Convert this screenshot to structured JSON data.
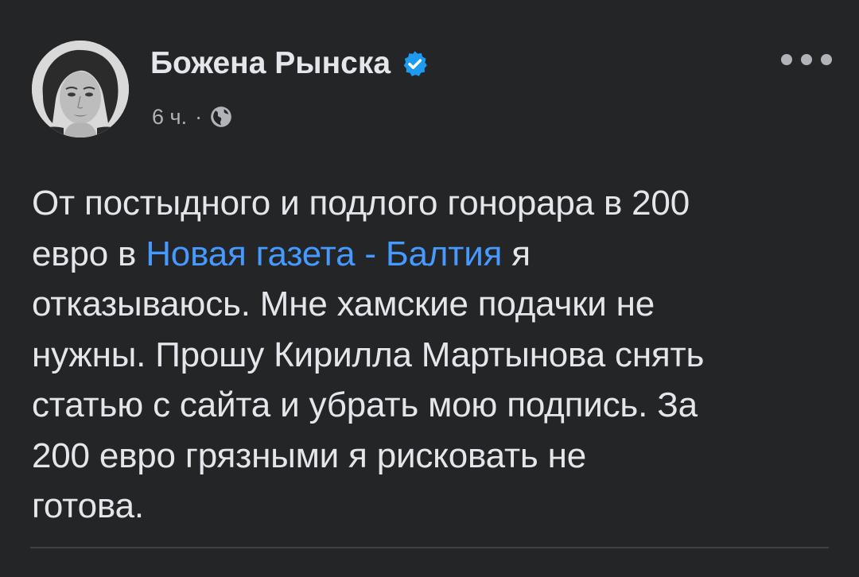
{
  "post": {
    "author_name": "Божена Рынска",
    "timestamp": "6 ч.",
    "separator": "·",
    "privacy_icon": "globe-icon",
    "verified_icon": "verified-badge-icon",
    "more_icon": "more-options-icon",
    "text": {
      "line1": "От постыдного и подлого гонорара в 200",
      "line2_before": "евро в ",
      "line2_link": "Новая газета - Балтия",
      "line2_after": " я",
      "line3": "отказываюсь. Мне хамские подачки не",
      "line4": "нужны. Прошу Кирилла Мартынова снять",
      "line5": "статью с сайта и убрать мою подпись. За",
      "line6": "200 евро грязными я рисковать не",
      "line7": "готова."
    }
  },
  "colors": {
    "background": "#242526",
    "primary_text": "#e4e6eb",
    "secondary_text": "#b0b3b8",
    "link": "#4599ff",
    "verified": "#1d9bf0",
    "divider": "#3e4042"
  }
}
